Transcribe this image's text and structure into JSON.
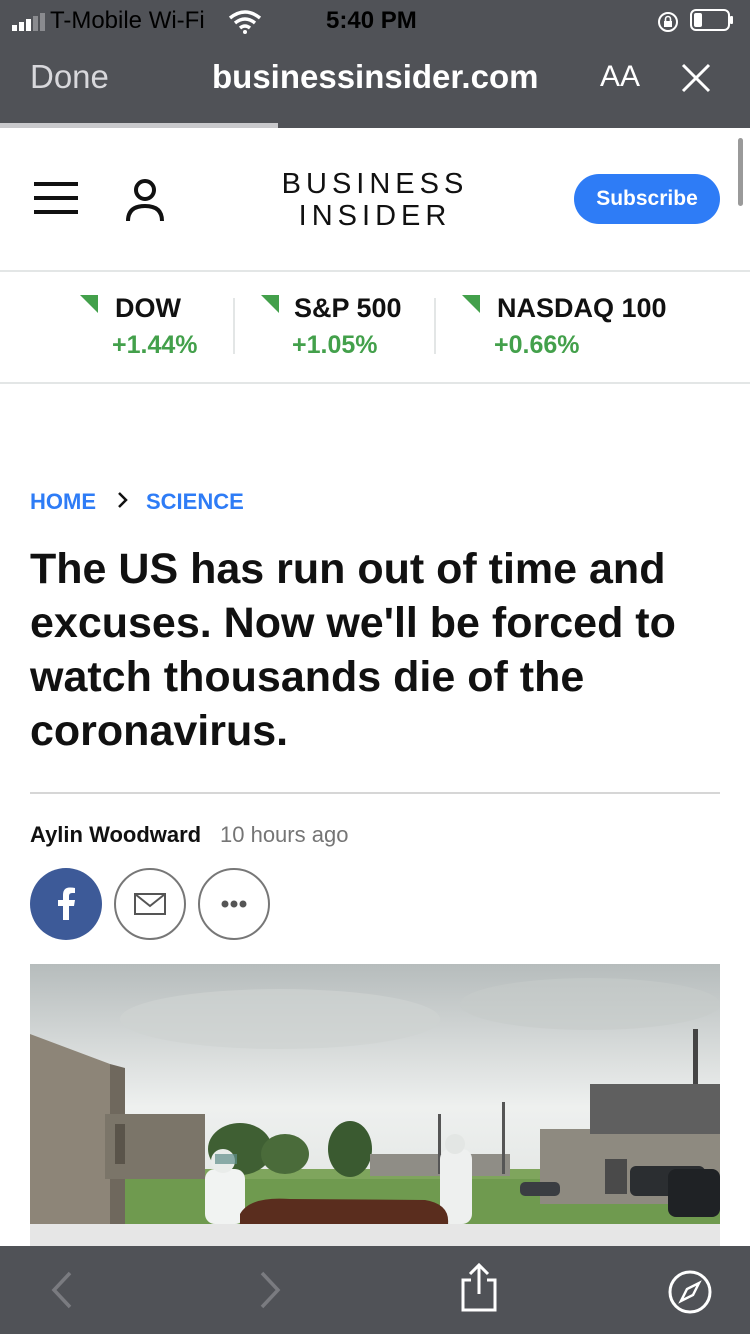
{
  "status_bar": {
    "carrier": "T-Mobile Wi-Fi",
    "time": "5:40 PM"
  },
  "browser": {
    "done_label": "Done",
    "url": "businessinsider.com",
    "text_size_label": "AA",
    "load_progress": 0.37
  },
  "site_header": {
    "logo_line1": "BUSINESS",
    "logo_line2": "INSIDER",
    "subscribe_label": "Subscribe"
  },
  "tickers": [
    {
      "name": "DOW",
      "change": "+1.44%"
    },
    {
      "name": "S&P 500",
      "change": "+1.05%"
    },
    {
      "name": "NASDAQ 100",
      "change": "+0.66%"
    }
  ],
  "breadcrumb": {
    "home": "HOME",
    "section": "SCIENCE"
  },
  "article": {
    "headline": "The US has run out of time and excuses. Now we'll be forced to watch thousands die of the coronavirus.",
    "author": "Aylin Woodward",
    "time_ago": "10 hours ago"
  },
  "share_icons": [
    "facebook-icon",
    "mail-icon",
    "more-icon"
  ],
  "toolbar_icons": [
    "back-icon",
    "forward-icon",
    "share-icon",
    "compass-icon"
  ],
  "colors": {
    "browser_chrome": "#505257",
    "accent_blue": "#2e7cf6",
    "market_green": "#43a04b",
    "facebook_blue": "#3d5a98"
  }
}
